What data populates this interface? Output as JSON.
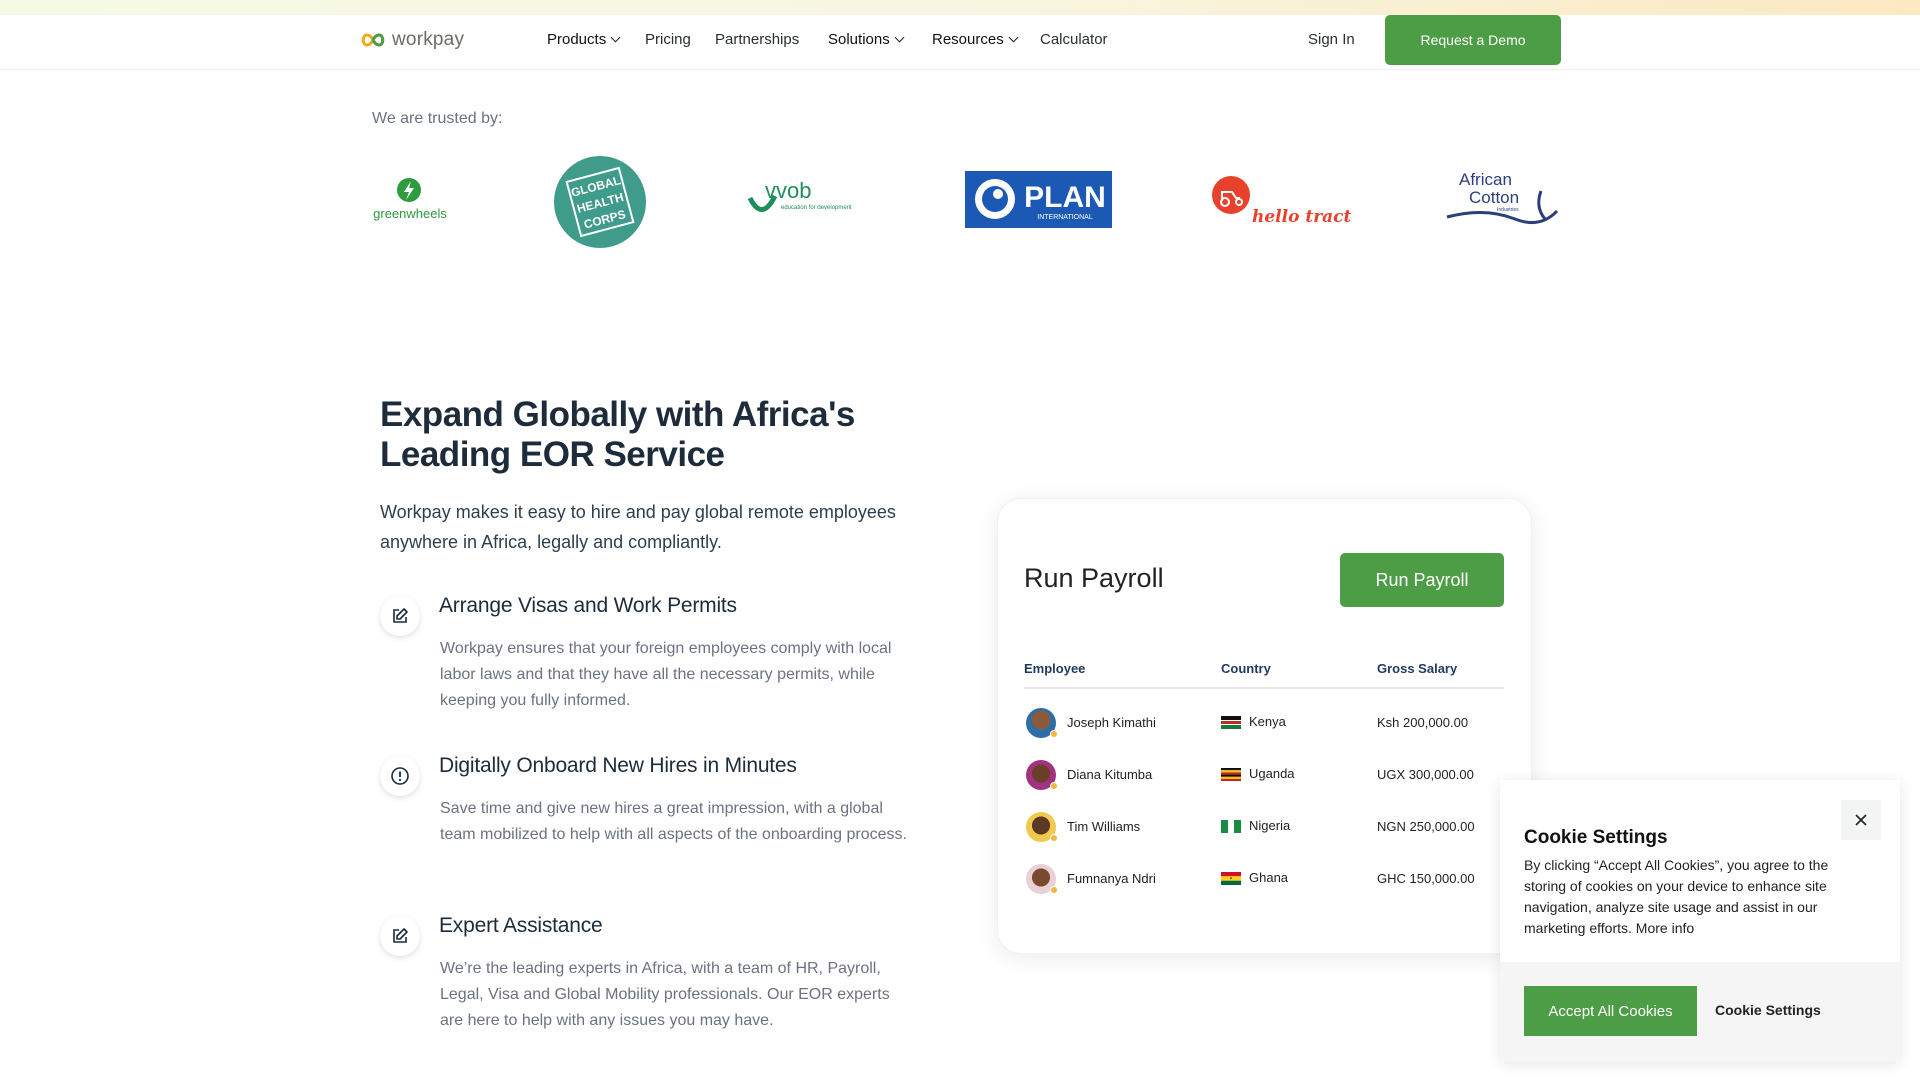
{
  "nav": {
    "logo_text": "workpay",
    "items": [
      {
        "label": "Products",
        "dropdown": true
      },
      {
        "label": "Pricing",
        "dropdown": false
      },
      {
        "label": "Partnerships",
        "dropdown": false
      },
      {
        "label": "Solutions",
        "dropdown": true
      },
      {
        "label": "Resources",
        "dropdown": true
      },
      {
        "label": "Calculator",
        "dropdown": false
      }
    ],
    "sign_in": "Sign In",
    "demo_button": "Request a Demo"
  },
  "trusted": {
    "label": "We are trusted by:",
    "logos": [
      {
        "name": "greenwheels",
        "text": "greenwheels",
        "color": "#2e9b3f"
      },
      {
        "name": "global-health-corps",
        "lines": [
          "GLOBAL",
          "HEALTH",
          "CORPS"
        ],
        "color": "#3f9b8a"
      },
      {
        "name": "vvob",
        "text": "vvob",
        "tagline": "education for development",
        "color": "#1e8f5a"
      },
      {
        "name": "plan-international",
        "text": "PLAN",
        "sub": "INTERNATIONAL",
        "color": "#1c59b4"
      },
      {
        "name": "hello-tractor",
        "text": "hello tractor",
        "color": "#e8412c"
      },
      {
        "name": "african-cotton",
        "lines": [
          "African",
          "Cotton"
        ],
        "sub": "Industries",
        "color": "#2c3f7a"
      }
    ]
  },
  "hero": {
    "title": "Expand Globally with Africa's Leading EOR Service",
    "subtitle": "Workpay makes it easy to hire and pay global remote employees anywhere in Africa, legally and compliantly."
  },
  "features": [
    {
      "title": "Arrange Visas and Work Permits",
      "text": "Workpay ensures that your foreign employees comply with local labor laws and that they have all the necessary permits, while keeping you fully informed.",
      "icon": "edit-icon"
    },
    {
      "title": "Digitally Onboard New Hires in Minutes",
      "text": "Save time and give new hires a great impression, with a global team mobilized to help with all aspects of the onboarding process.",
      "icon": "info-icon"
    },
    {
      "title": "Expert Assistance",
      "text": "We’re the leading experts in Africa, with a team of HR, Payroll, Legal, Visa and Global Mobility professionals. Our EOR experts are here to help with any issues you may have.",
      "icon": "edit-icon"
    }
  ],
  "payroll": {
    "title": "Run Payroll",
    "button": "Run Payroll",
    "columns": [
      "Employee",
      "Country",
      "Gross Salary"
    ],
    "rows": [
      {
        "name": "Joseph Kimathi",
        "country": "Kenya",
        "salary": "Ksh 200,000.00",
        "flag": "kenya"
      },
      {
        "name": "Diana  Kitumba",
        "country": "Uganda",
        "salary": "UGX 300,000.00",
        "flag": "uganda"
      },
      {
        "name": "Tim Williams",
        "country": "Nigeria",
        "salary": "NGN 250,000.00",
        "flag": "nigeria"
      },
      {
        "name": "Fumnanya  Ndri",
        "country": "Ghana",
        "salary": "GHC 150,000.00",
        "flag": "ghana"
      }
    ]
  },
  "cookie": {
    "title": "Cookie Settings",
    "text": "By clicking “Accept All Cookies”, you agree to the storing of cookies on your device to enhance site navigation, analyze site usage and assist in our marketing efforts.",
    "more_info": "More info",
    "accept": "Accept All Cookies",
    "settings": "Cookie Settings"
  },
  "colors": {
    "brand_green": "#4d9d46",
    "heading": "#1d2b3a"
  }
}
